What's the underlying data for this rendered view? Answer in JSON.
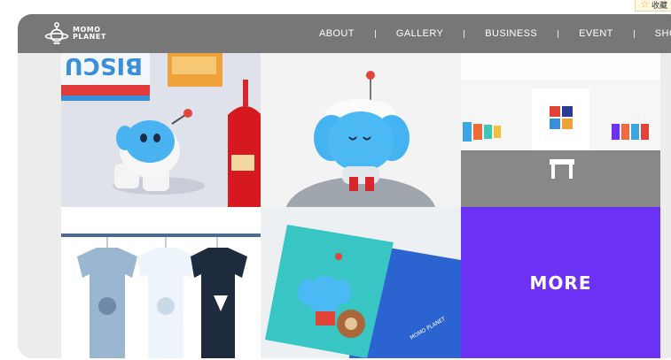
{
  "browser": {
    "bookmark_label": "收藏",
    "bookmark_icon": "star-icon"
  },
  "header": {
    "logo_line1": "MOMO",
    "logo_line2": "PLANET",
    "nav": [
      {
        "label": "ABOUT"
      },
      {
        "label": "GALLERY"
      },
      {
        "label": "BUSINESS"
      },
      {
        "label": "EVENT"
      },
      {
        "label": "SHO"
      }
    ]
  },
  "gallery": {
    "more_label": "MORE"
  },
  "colors": {
    "header_bg": "#777777",
    "more_tile_bg": "#6b31f5",
    "momo_blue": "#42b4f0"
  }
}
